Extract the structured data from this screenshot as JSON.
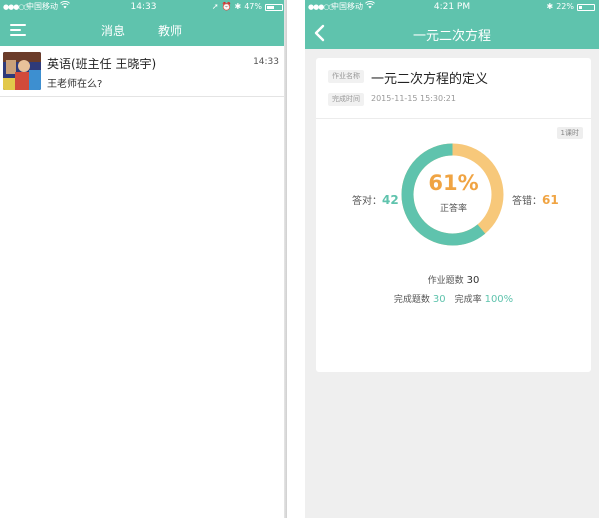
{
  "left_screen": {
    "status_bar": {
      "signal": "●●●○○",
      "carrier": "中国移动",
      "time": "14:33",
      "battery_percent": "47%",
      "battery_level": 0.47
    },
    "tabs": [
      {
        "label": "消息",
        "active": true
      },
      {
        "label": "教师",
        "active": false
      }
    ],
    "messages": [
      {
        "name": "英语(班主任 王晓宇)",
        "preview": "王老师在么?",
        "time": "14:33"
      }
    ]
  },
  "right_screen": {
    "status_bar": {
      "signal": "●●●○○",
      "carrier": "中国移动",
      "time": "4:21 PM",
      "battery_percent": "22%",
      "battery_level": 0.22
    },
    "nav_title": "一元二次方程",
    "homework": {
      "name_label": "作业名称",
      "name": "一元二次方程的定义",
      "time_label": "完成时间",
      "time": "2015-11-15 15:30:21",
      "hours_badge": "1课时"
    },
    "stats": {
      "correct_label": "答对：",
      "correct_value": "42",
      "wrong_label": "答错：",
      "wrong_value": "61",
      "accuracy_percent": "61%",
      "accuracy_fraction": 0.61,
      "accuracy_label": "正答率",
      "total_label": "作业题数",
      "total_value": "30",
      "done_label": "完成题数",
      "done_value": "30",
      "completion_label": "完成率",
      "completion_value": "100%"
    },
    "colors": {
      "primary": "#5fc3ad",
      "accent": "#f0a443",
      "donut_track": "#f7c87a"
    }
  }
}
